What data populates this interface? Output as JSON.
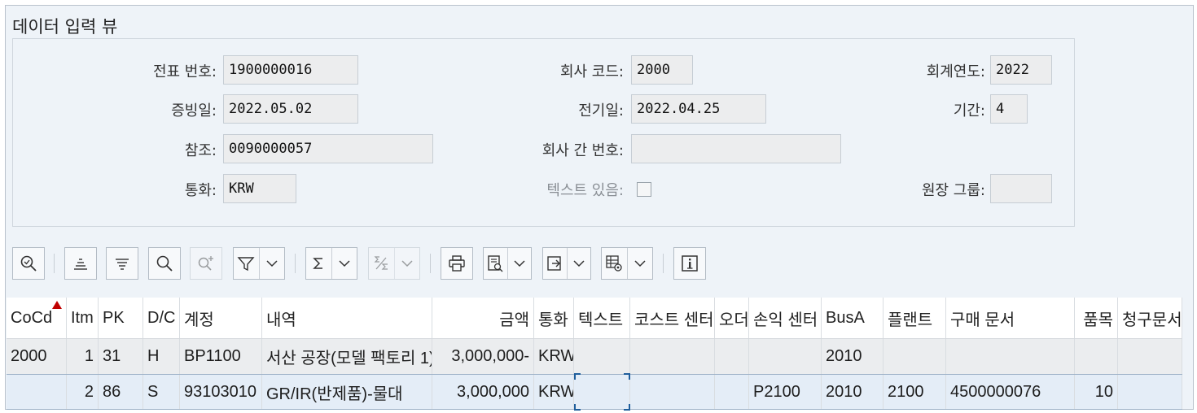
{
  "view_title": "데이터 입력 뷰",
  "form": {
    "doc_no_label": "전표 번호:",
    "doc_no": "1900000016",
    "company_label": "회사 코드:",
    "company": "2000",
    "fiscal_year_label": "회계연도:",
    "fiscal_year": "2022",
    "doc_date_label": "증빙일:",
    "doc_date": "2022.05.02",
    "posting_date_label": "전기일:",
    "posting_date": "2022.04.25",
    "period_label": "기간:",
    "period": "4",
    "reference_label": "참조:",
    "reference": "0090000057",
    "intercompany_label": "회사 간 번호:",
    "intercompany": "",
    "currency_label": "통화:",
    "currency": "KRW",
    "text_exists_label": "텍스트 있음:",
    "ledger_group_label": "원장 그룹:",
    "ledger_group": ""
  },
  "toolbar": [
    "details-icon",
    "sort-ascending-icon",
    "sort-descending-icon",
    "find-icon",
    "find-next-icon",
    "filter-icon",
    "sum-icon",
    "subtotal-icon",
    "print-icon",
    "view-icon",
    "export-icon",
    "layout-icon",
    "info-icon"
  ],
  "table": {
    "headers": [
      "CoCd",
      "Itm",
      "PK",
      "D/C",
      "계정",
      "내역",
      "금액",
      "통화",
      "텍스트",
      "코스트 센터",
      "오더",
      "손익 센터",
      "BusA",
      "플랜트",
      "구매 문서",
      "품목",
      "청구문서"
    ],
    "rows": [
      [
        "2000",
        "1",
        "31",
        "H",
        "BP1100",
        "서산 공장(모델 팩토리 1)",
        "3,000,000-",
        "KRW",
        "",
        "",
        "",
        "",
        "2010",
        "",
        "",
        "",
        ""
      ],
      [
        "",
        "2",
        "86",
        "S",
        "93103010",
        "GR/IR(반제품)-물대",
        "3,000,000",
        "KRW",
        "",
        "",
        "",
        "P2100",
        "2010",
        "2100",
        "4500000076",
        "10",
        ""
      ]
    ]
  },
  "colors": {
    "accent": "#1f5e9c",
    "sort_marker": "#c00000",
    "selected_row": "#e4edf7"
  }
}
